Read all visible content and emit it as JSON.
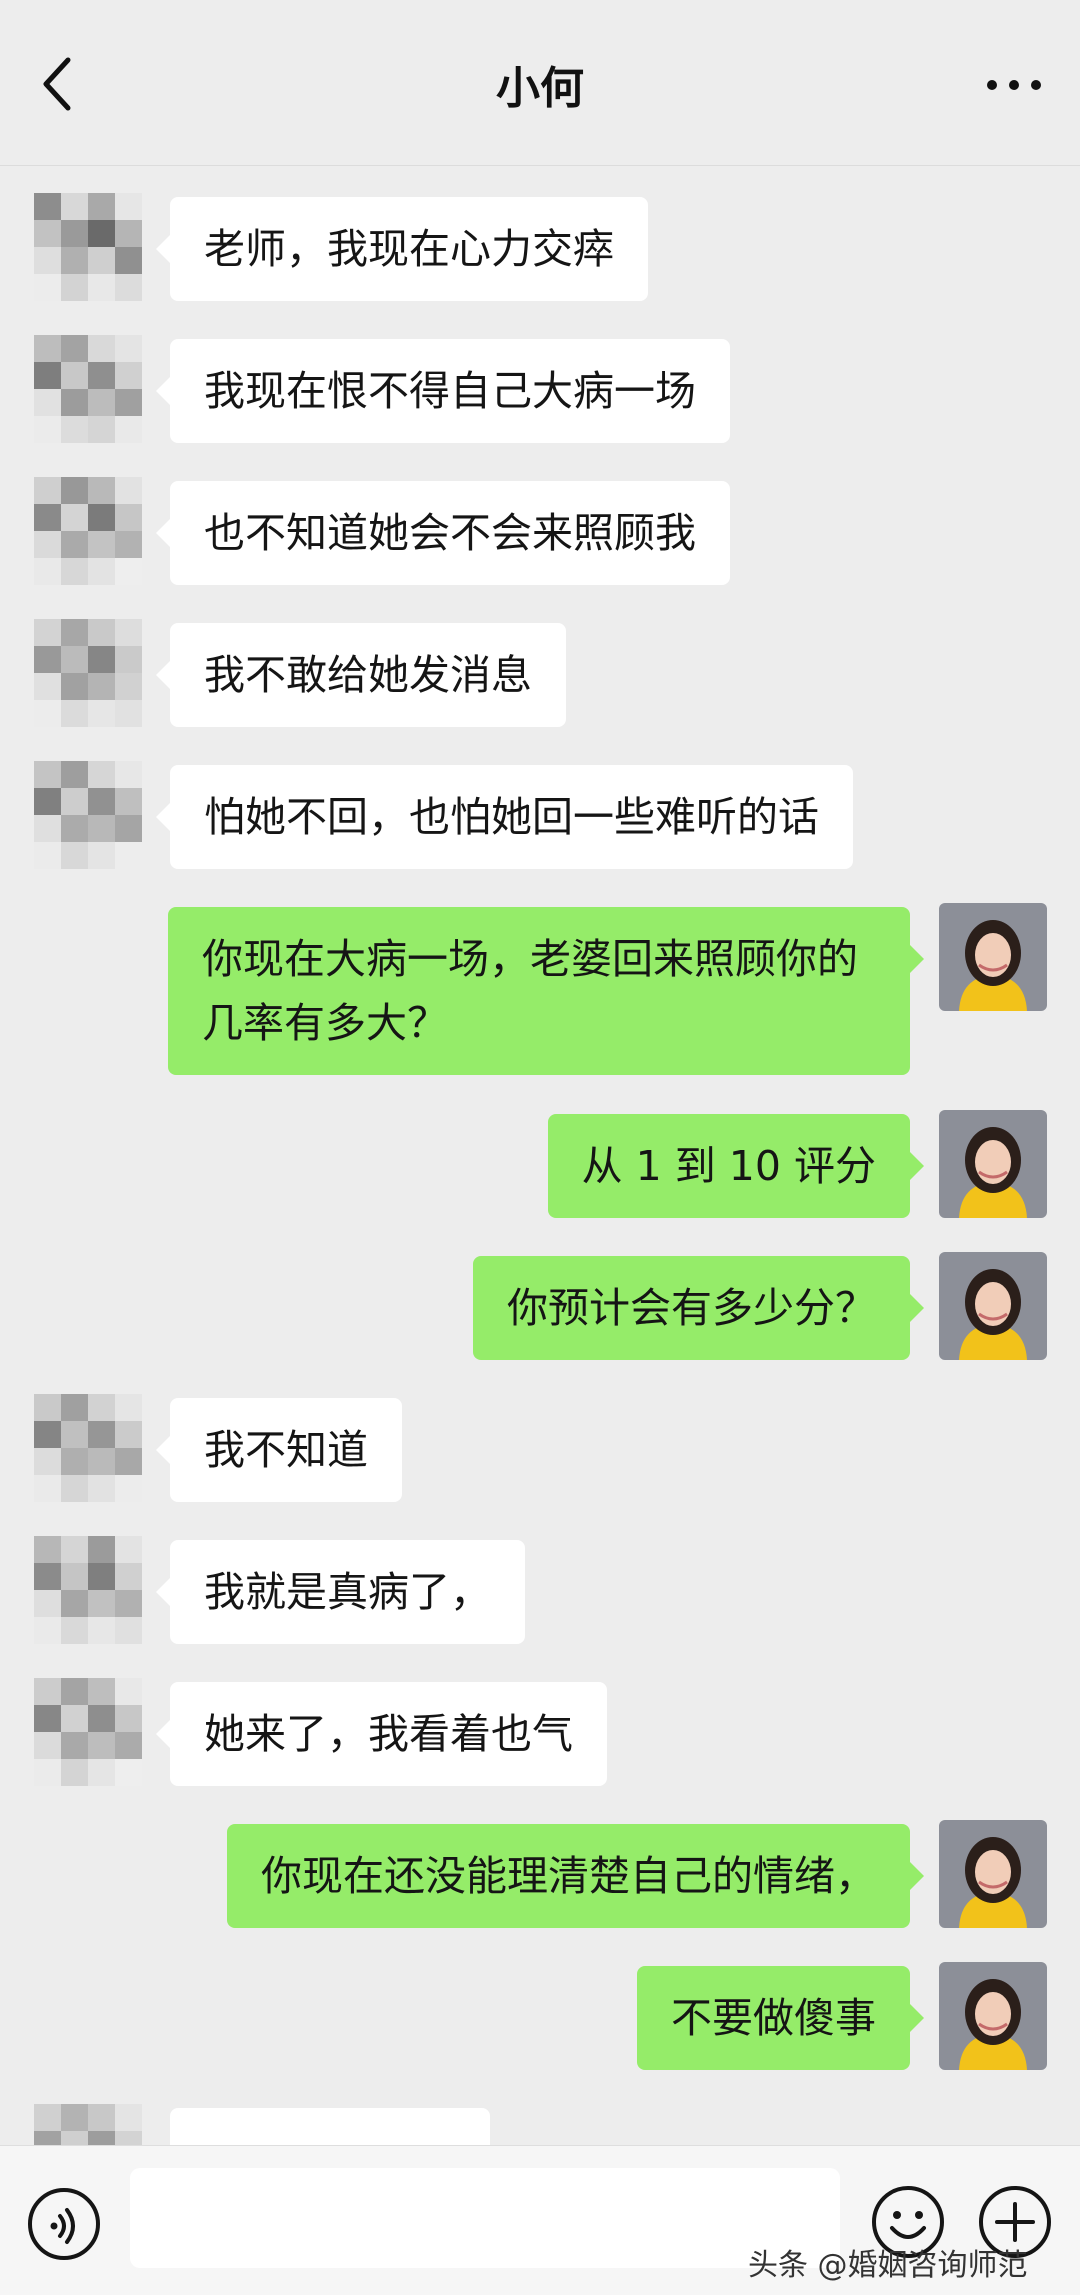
{
  "header": {
    "back_icon": "chevron-left-icon",
    "title": "小何",
    "more_icon": "more-dots-icon"
  },
  "messages": [
    {
      "side": "in",
      "text": "老师，我现在心力交瘁"
    },
    {
      "side": "in",
      "text": "我现在恨不得自己大病一场"
    },
    {
      "side": "in",
      "text": "也不知道她会不会来照顾我"
    },
    {
      "side": "in",
      "text": "我不敢给她发消息"
    },
    {
      "side": "in",
      "text": "怕她不回，也怕她回一些难听的话"
    },
    {
      "side": "out",
      "text": "你现在大病一场，老婆回来照顾你的几率有多大？"
    },
    {
      "side": "out",
      "text": "从 1 到 10 评分"
    },
    {
      "side": "out",
      "text": "你预计会有多少分？"
    },
    {
      "side": "in",
      "text": "我不知道"
    },
    {
      "side": "in",
      "text": "我就是真病了，"
    },
    {
      "side": "in",
      "text": "她来了，我看着也气"
    },
    {
      "side": "out",
      "text": "你现在还没能理清楚自己的情绪，"
    },
    {
      "side": "out",
      "text": "不要做傻事"
    },
    {
      "side": "in",
      "text": ""
    }
  ],
  "bottom": {
    "voice_icon": "voice-icon",
    "emoji_icon": "emoji-icon",
    "plus_icon": "plus-icon"
  },
  "watermark": "头条 @婚姻咨询师范"
}
